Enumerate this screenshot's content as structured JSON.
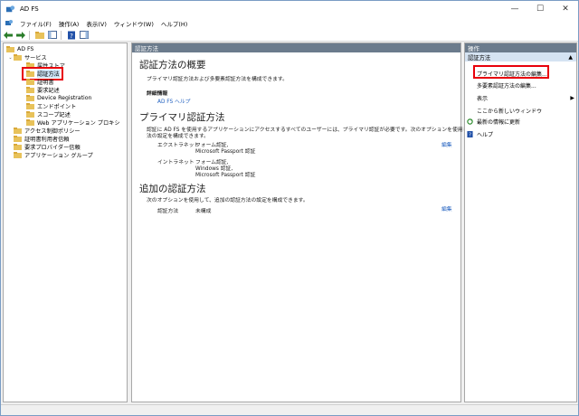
{
  "window": {
    "title": "AD FS",
    "controls": {
      "minimize": "—",
      "maximize": "☐",
      "close": "✕"
    }
  },
  "menu": [
    "ファイル(F)",
    "操作(A)",
    "表示(V)",
    "ウィンドウ(W)",
    "ヘルプ(H)"
  ],
  "tree": {
    "root": "AD FS",
    "service": "サービス",
    "service_children": [
      "属性ストア",
      "認証方法",
      "証明書",
      "要求記述",
      "Device Registration",
      "エンドポイント",
      "スコープ記述",
      "Web アプリケーション プロキシ"
    ],
    "others": [
      "アクセス制御ポリシー",
      "証明書利用者信頼",
      "要求プロバイダー信頼",
      "アプリケーション グループ"
    ]
  },
  "center": {
    "header": "認証方法",
    "overview_title": "認証方法の概要",
    "overview_desc": "プライマリ認証方法および多要素認証方法を構成できます。",
    "details_label": "詳細情報",
    "help_link": "AD FS ヘルプ",
    "primary_title": "プライマリ認証方法",
    "primary_desc_1": "認証に AD FS を使用するアプリケーションにアクセスするすべてのユーザーには、プライマリ認証が必要です。次のオプションを使用して、プライマリ認証方",
    "primary_desc_2": "法の設定を構成できます。",
    "extranet_label": "エクストラネット",
    "extranet_values": [
      "フォーム認証,",
      "Microsoft Passport 認証"
    ],
    "intranet_label": "イントラネット",
    "intranet_values": [
      "フォーム認証,",
      "Windows 認証,",
      "Microsoft Passport 認証"
    ],
    "edit_link": "編集",
    "additional_title": "追加の認証方法",
    "additional_desc": "次のオプションを使用して、追加の認証方法の設定を構成できます。",
    "additional_label": "認証方法",
    "additional_value": "未構成",
    "edit_link_2": "編集"
  },
  "actions": {
    "header": "操作",
    "section": "認証方法",
    "items": [
      "プライマリ認証方法の編集...",
      "多要素認証方法の編集...",
      "表示",
      "ここから新しいウィンドウ",
      "最新の情報に更新",
      "ヘルプ"
    ]
  },
  "colors": {
    "accent": "#6b7b8c",
    "highlight": "#e8000b",
    "link": "#1f5fbf",
    "folder": "#e8c25a"
  }
}
